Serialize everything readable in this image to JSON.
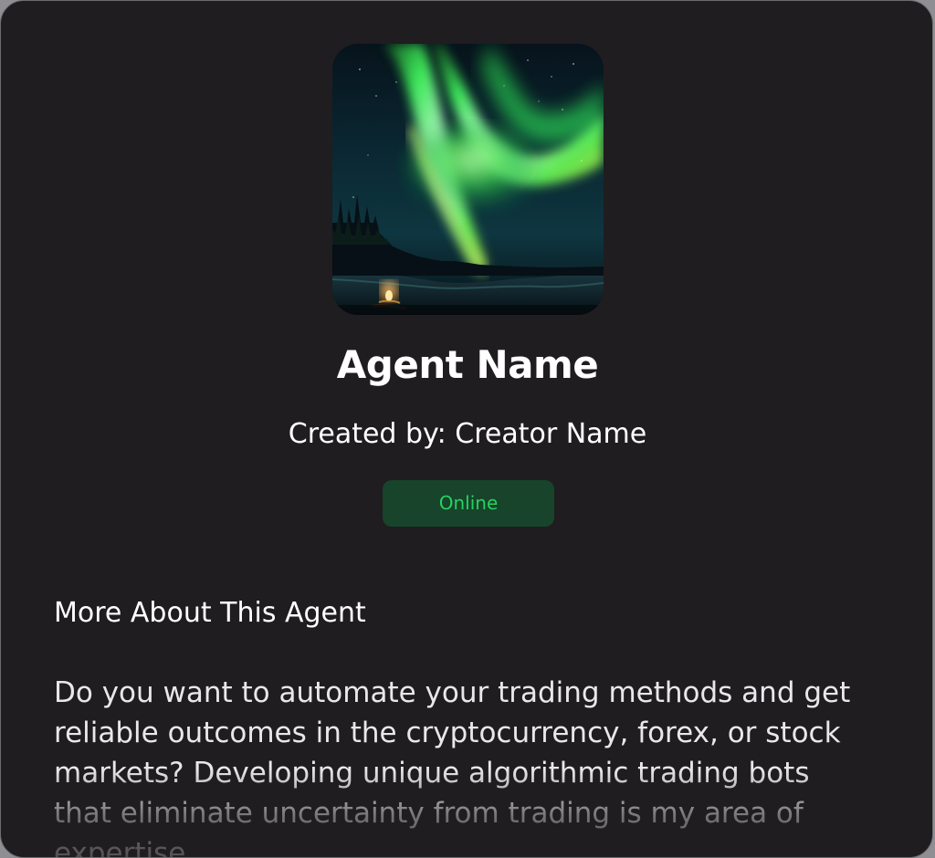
{
  "agent": {
    "name": "Agent Name",
    "creator_line": "Created by: Creator Name",
    "status": "Online"
  },
  "about": {
    "heading": "More About This Agent",
    "description": "Do you want to automate your trading methods and get reliable outcomes in the cryptocurrency, forex, or stock markets? Developing unique algorithmic trading bots that eliminate uncertainty from trading is my area of expertise."
  },
  "avatar_icon": "aurora-image",
  "colors": {
    "card_background": "#1f1d20",
    "status_badge_background": "#17442a",
    "status_text": "#27d15f"
  }
}
